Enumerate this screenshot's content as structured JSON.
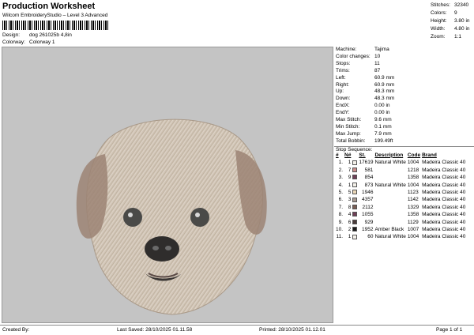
{
  "header": {
    "title": "Production Worksheet",
    "subtitle": "Wilcom EmbroideryStudio – Level 3 Advanced",
    "design_label": "Design:",
    "design_value": "dog 261025b 4,8in",
    "colorway_label": "Colorway:",
    "colorway_value": "Colorway 1"
  },
  "header_stats": [
    {
      "label": "Stitches:",
      "value": "32340"
    },
    {
      "label": "Colors:",
      "value": "9"
    },
    {
      "label": "Height:",
      "value": "3.80 in"
    },
    {
      "label": "Width:",
      "value": "4.80 in"
    },
    {
      "label": "Zoom:",
      "value": "1:1"
    }
  ],
  "machine_info": [
    {
      "label": "Machine:",
      "value": "Tajima"
    },
    {
      "label": "Color changes:",
      "value": "10"
    },
    {
      "label": "Stops:",
      "value": "11"
    },
    {
      "label": "Trims:",
      "value": "87"
    },
    {
      "label": "Left:",
      "value": "60.9 mm"
    },
    {
      "label": "Right:",
      "value": "60.9 mm"
    },
    {
      "label": "Up:",
      "value": "48.3 mm"
    },
    {
      "label": "Down:",
      "value": "48.3 mm"
    },
    {
      "label": "EndX:",
      "value": "0.00 in"
    },
    {
      "label": "EndY:",
      "value": "0.00 in"
    },
    {
      "label": "Max Stitch:",
      "value": "9.6 mm"
    },
    {
      "label": "Min Stitch:",
      "value": "0.1 mm"
    },
    {
      "label": "Max Jump:",
      "value": "7.9 mm"
    },
    {
      "label": "Total Bobbin:",
      "value": "199.49ft"
    }
  ],
  "stop_sequence": {
    "title": "Stop Sequence:",
    "columns": [
      "#",
      "N#",
      "St.",
      "Description",
      "Code",
      "Brand"
    ],
    "rows": [
      {
        "idx": "1.",
        "n": "1",
        "color": "#f4f1ea",
        "st": "17619",
        "desc": "Natural White",
        "code": "1004",
        "brand": "Madeira Classic 40"
      },
      {
        "idx": "2.",
        "n": "7",
        "color": "#c98e8c",
        "st": "581",
        "desc": "",
        "code": "1218",
        "brand": "Madeira Classic 40"
      },
      {
        "idx": "3.",
        "n": "9",
        "color": "#6e3f56",
        "st": "854",
        "desc": "",
        "code": "1358",
        "brand": "Madeira Classic 40"
      },
      {
        "idx": "4.",
        "n": "1",
        "color": "#f4f1ea",
        "st": "873",
        "desc": "Natural White",
        "code": "1004",
        "brand": "Madeira Classic 40"
      },
      {
        "idx": "5.",
        "n": "5",
        "color": "#ead7b8",
        "st": "1946",
        "desc": "",
        "code": "1123",
        "brand": "Madeira Classic 40"
      },
      {
        "idx": "6.",
        "n": "3",
        "color": "#a89a92",
        "st": "4357",
        "desc": "",
        "code": "1142",
        "brand": "Madeira Classic 40"
      },
      {
        "idx": "7.",
        "n": "8",
        "color": "#7a5e55",
        "st": "2112",
        "desc": "",
        "code": "1329",
        "brand": "Madeira Classic 40"
      },
      {
        "idx": "8.",
        "n": "4",
        "color": "#6e3f56",
        "st": "1055",
        "desc": "",
        "code": "1358",
        "brand": "Madeira Classic 40"
      },
      {
        "idx": "9.",
        "n": "6",
        "color": "#4a3b3a",
        "st": "929",
        "desc": "",
        "code": "1129",
        "brand": "Madeira Classic 40"
      },
      {
        "idx": "10.",
        "n": "2",
        "color": "#1a1a1a",
        "st": "1952",
        "desc": "Amber Black",
        "code": "1007",
        "brand": "Madeira Classic 40"
      },
      {
        "idx": "11.",
        "n": "1",
        "color": "#f4f1ea",
        "st": "60",
        "desc": "Natural White",
        "code": "1004",
        "brand": "Madeira Classic 40"
      }
    ]
  },
  "footer": {
    "created_by": "Created By:",
    "last_saved": "Last Saved: 28/10/2025 01.11.58",
    "printed": "Printed: 28/10/2025 01.12.01",
    "page": "Page 1 of 1"
  },
  "colors": {
    "canvas_bg": "#c4c4c4"
  }
}
